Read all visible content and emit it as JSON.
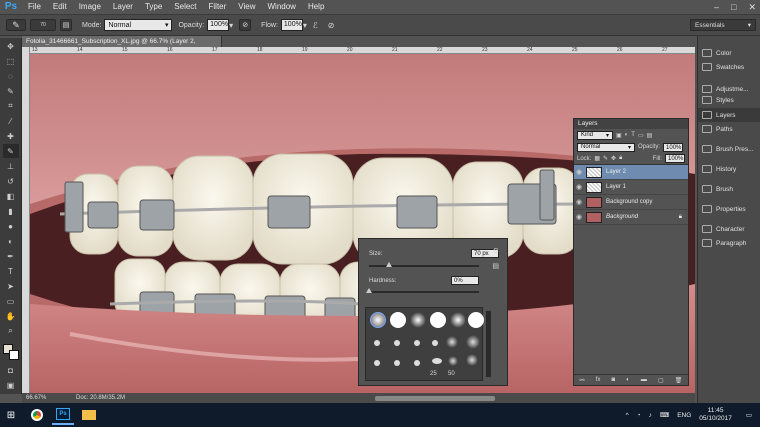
{
  "app": {
    "logo": "Ps"
  },
  "menu": [
    "File",
    "Edit",
    "Image",
    "Layer",
    "Type",
    "Select",
    "Filter",
    "View",
    "Window",
    "Help"
  ],
  "window_controls": {
    "minimize": "–",
    "maximize": "□",
    "close": "✕"
  },
  "options": {
    "mode_label": "Mode:",
    "mode_value": "Normal",
    "opacity_label": "Opacity:",
    "opacity_value": "100%",
    "flow_label": "Flow:",
    "flow_value": "100%",
    "brush_size_badge": "70"
  },
  "workspace": "Essentials",
  "document": {
    "tab_title": "Fotolia_31466661_Subscription_XL.jpg @ 66.7% (Layer 2, RGB/8#) *",
    "zoom": "66.67%",
    "doc_info": "Doc: 20.8M/35.2M",
    "ruler_labels": [
      "13",
      "14",
      "15",
      "16",
      "17",
      "18",
      "19",
      "20",
      "21",
      "22",
      "23",
      "24",
      "25",
      "26",
      "27"
    ]
  },
  "right_dock": {
    "items": [
      "Color",
      "Swatches",
      "Adjustme...",
      "Styles",
      "Layers",
      "Paths",
      "Brush Pres...",
      "History",
      "Brush",
      "Properties",
      "Character",
      "Paragraph"
    ]
  },
  "layers_panel": {
    "title": "Layers",
    "filter_kind": "Kind",
    "blend_mode": "Normal",
    "opacity_label": "Opacity:",
    "opacity_value": "100%",
    "lock_label": "Lock:",
    "fill_label": "Fill:",
    "fill_value": "100%",
    "layers": [
      {
        "name": "Layer 2",
        "selected": true
      },
      {
        "name": "Layer 1",
        "selected": false
      },
      {
        "name": "Background copy",
        "selected": false
      },
      {
        "name": "Background",
        "selected": false
      }
    ]
  },
  "brush_popup": {
    "size_label": "Size:",
    "size_value": "70 px",
    "size_fraction": 0.18,
    "hardness_label": "Hardness:",
    "hardness_value": "0%",
    "hardness_fraction": 0.0,
    "preset_labels": [
      "25",
      "50"
    ]
  },
  "taskbar": {
    "time": "11:45",
    "date": "05/10/2017",
    "lang": "ENG"
  }
}
